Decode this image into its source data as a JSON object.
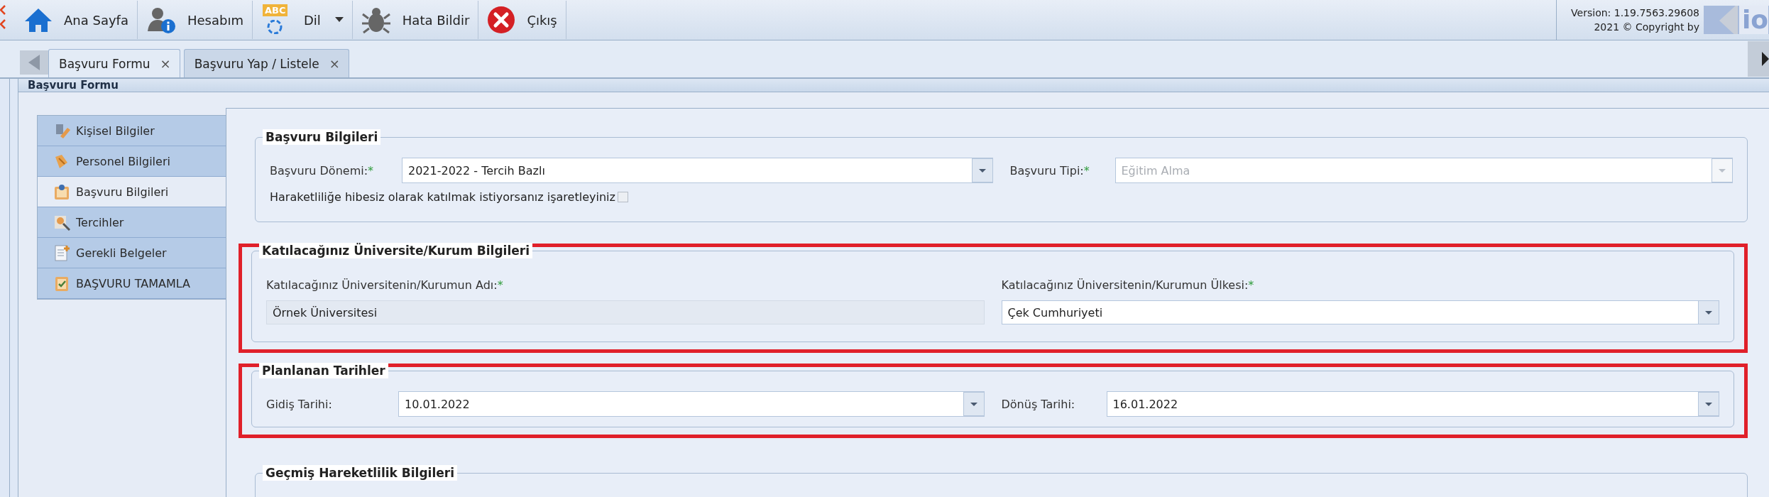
{
  "toolbar": {
    "buttons": [
      {
        "kind": "home",
        "label": "Ana Sayfa",
        "has_menu": false
      },
      {
        "kind": "account",
        "label": "Hesabım",
        "has_menu": false
      },
      {
        "kind": "language",
        "label": "Dil",
        "icon_text": "ABC",
        "has_menu": true
      },
      {
        "kind": "bug",
        "label": "Hata Bildir",
        "has_menu": false
      },
      {
        "kind": "exit",
        "label": "Çıkış",
        "has_menu": false
      }
    ],
    "version": "Version: 1.19.7563.29608",
    "copyright": "2021 © Copyright by",
    "logo_text": "io"
  },
  "tabs": [
    {
      "label": "Başvuru Formu",
      "close": "×",
      "selected": true
    },
    {
      "label": "Başvuru Yap / Listele",
      "close": "×",
      "selected": false
    }
  ],
  "panel": {
    "title": "Başvuru Formu"
  },
  "nav": [
    {
      "kind": "person",
      "label": "Kişisel Bilgiler",
      "selected": false
    },
    {
      "kind": "staff",
      "label": "Personel Bilgileri",
      "selected": false
    },
    {
      "kind": "form",
      "label": "Başvuru Bilgileri",
      "selected": true
    },
    {
      "kind": "search",
      "label": "Tercihler",
      "selected": false
    },
    {
      "kind": "document",
      "label": "Gerekli Belgeler",
      "selected": false
    },
    {
      "kind": "clipboard",
      "label": "BAŞVURU TAMAMLA",
      "selected": false
    }
  ],
  "sections": [
    {
      "title": "Başvuru Bilgileri",
      "kind": "inline",
      "highlighted": false,
      "fields": [
        {
          "label": "Başvuru Dönemi:",
          "required_mark": "*",
          "kind": "combo",
          "value": "2021-2022 - Tercih Bazlı",
          "disabled": false
        },
        {
          "label": "Başvuru Tipi:",
          "required_mark": "*",
          "kind": "combo",
          "value": "Eğitim Alma",
          "disabled": true
        }
      ],
      "checkbox": {
        "label": "Haraketliliğe hibesiz olarak katılmak istiyorsanız işaretleyiniz",
        "checked": false
      }
    },
    {
      "title": "Katılacağınız Üniversite/Kurum Bilgileri",
      "kind": "stacked",
      "highlighted": true,
      "fields": [
        {
          "label": "Katılacağınız Üniversitenin/Kurumun Adı:",
          "required_mark": "*",
          "kind": "text",
          "value": "Örnek Üniversitesi",
          "readonly": true
        },
        {
          "label": "Katılacağınız Üniversitenin/Kurumun Ülkesi:",
          "required_mark": "*",
          "kind": "combo",
          "value": "Çek Cumhuriyeti",
          "disabled": false
        }
      ]
    },
    {
      "title": "Planlanan Tarihler",
      "kind": "inline",
      "highlighted": true,
      "fields": [
        {
          "label": "Gidiş Tarihi:",
          "kind": "combo",
          "value": "10.01.2022",
          "disabled": false
        },
        {
          "label": "Dönüş Tarihi:",
          "kind": "combo",
          "value": "16.01.2022",
          "disabled": false
        }
      ]
    },
    {
      "title": "Geçmiş Hareketlilik Bilgileri",
      "kind": "inline",
      "highlighted": false
    }
  ]
}
